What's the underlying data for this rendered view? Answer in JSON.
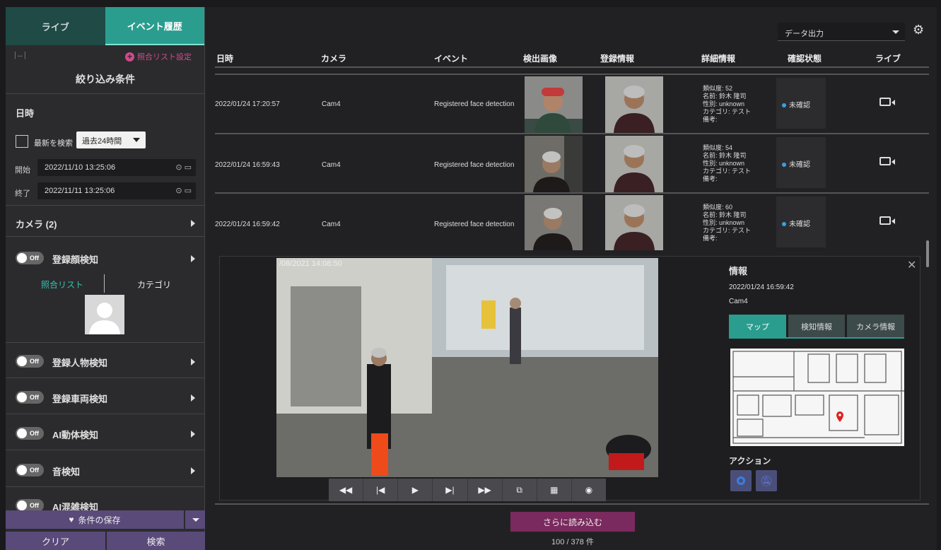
{
  "tabs": {
    "live": "ライブ",
    "history": "イベント履歴"
  },
  "left": {
    "collapse_icon": "|↔|",
    "match_list_setting": "照合リスト設定",
    "filter_title": "絞り込み条件",
    "datetime_title": "日時",
    "latest_search": "最新を検索",
    "period_select": "過去24時間",
    "start_label": "開始",
    "start_value": "2022/11/10  13:25:06",
    "end_label": "終了",
    "end_value": "2022/11/11  13:25:06",
    "camera_title": "カメラ (2)",
    "off_label": "Off",
    "face_detect": "登録顔検知",
    "match_list_tab": "照合リスト",
    "category_tab": "カテゴリ",
    "person_detect": "登録人物検知",
    "vehicle_detect": "登録車両検知",
    "ai_motion": "AI動体検知",
    "sound_detect": "音検知",
    "ai_crowd": "AI混雑検知",
    "save_conditions": "条件の保存",
    "clear": "クリア",
    "search": "検索"
  },
  "toolbar": {
    "data_output": "データ出力",
    "settings_icon": "gear-icon"
  },
  "table": {
    "headers": [
      "日時",
      "カメラ",
      "イベント",
      "検出画像",
      "登録情報",
      "詳細情報",
      "確認状態",
      "ライブ"
    ],
    "rows": [
      {
        "datetime": "2022/01/24 17:20:57",
        "camera": "Cam4",
        "event": "Registered face detection",
        "detail": [
          "類似度: 52",
          "名前: 鈴木 隆司",
          "性別: unknown",
          "カテゴリ: テスト",
          "備考:"
        ],
        "status": "未確認"
      },
      {
        "datetime": "2022/01/24 16:59:43",
        "camera": "Cam4",
        "event": "Registered face detection",
        "detail": [
          "類似度: 54",
          "名前: 鈴木 隆司",
          "性別: unknown",
          "カテゴリ: テスト",
          "備考:"
        ],
        "status": "未確認"
      },
      {
        "datetime": "2022/01/24 16:59:42",
        "camera": "Cam4",
        "event": "Registered face detection",
        "detail": [
          "類似度: 60",
          "名前: 鈴木 隆司",
          "性別: unknown",
          "カテゴリ: テスト",
          "備考:"
        ],
        "status": "未確認"
      }
    ]
  },
  "viewer": {
    "overlay_timestamp": "/08/2021 14:08:50",
    "info_title": "情報",
    "info_date": "2022/01/24 16:59:42",
    "info_camera": "Cam4",
    "info_tabs": [
      "マップ",
      "検知情報",
      "カメラ情報"
    ],
    "action_title": "アクション"
  },
  "footer": {
    "load_more": "さらに読み込む",
    "count": "100 / 378 件"
  },
  "colors": {
    "accent": "#2a9d8f",
    "button": "#5a4a7a",
    "load_more": "#7a2a5e",
    "status_dot": "#3aa0e0",
    "pin": "#e02020"
  }
}
